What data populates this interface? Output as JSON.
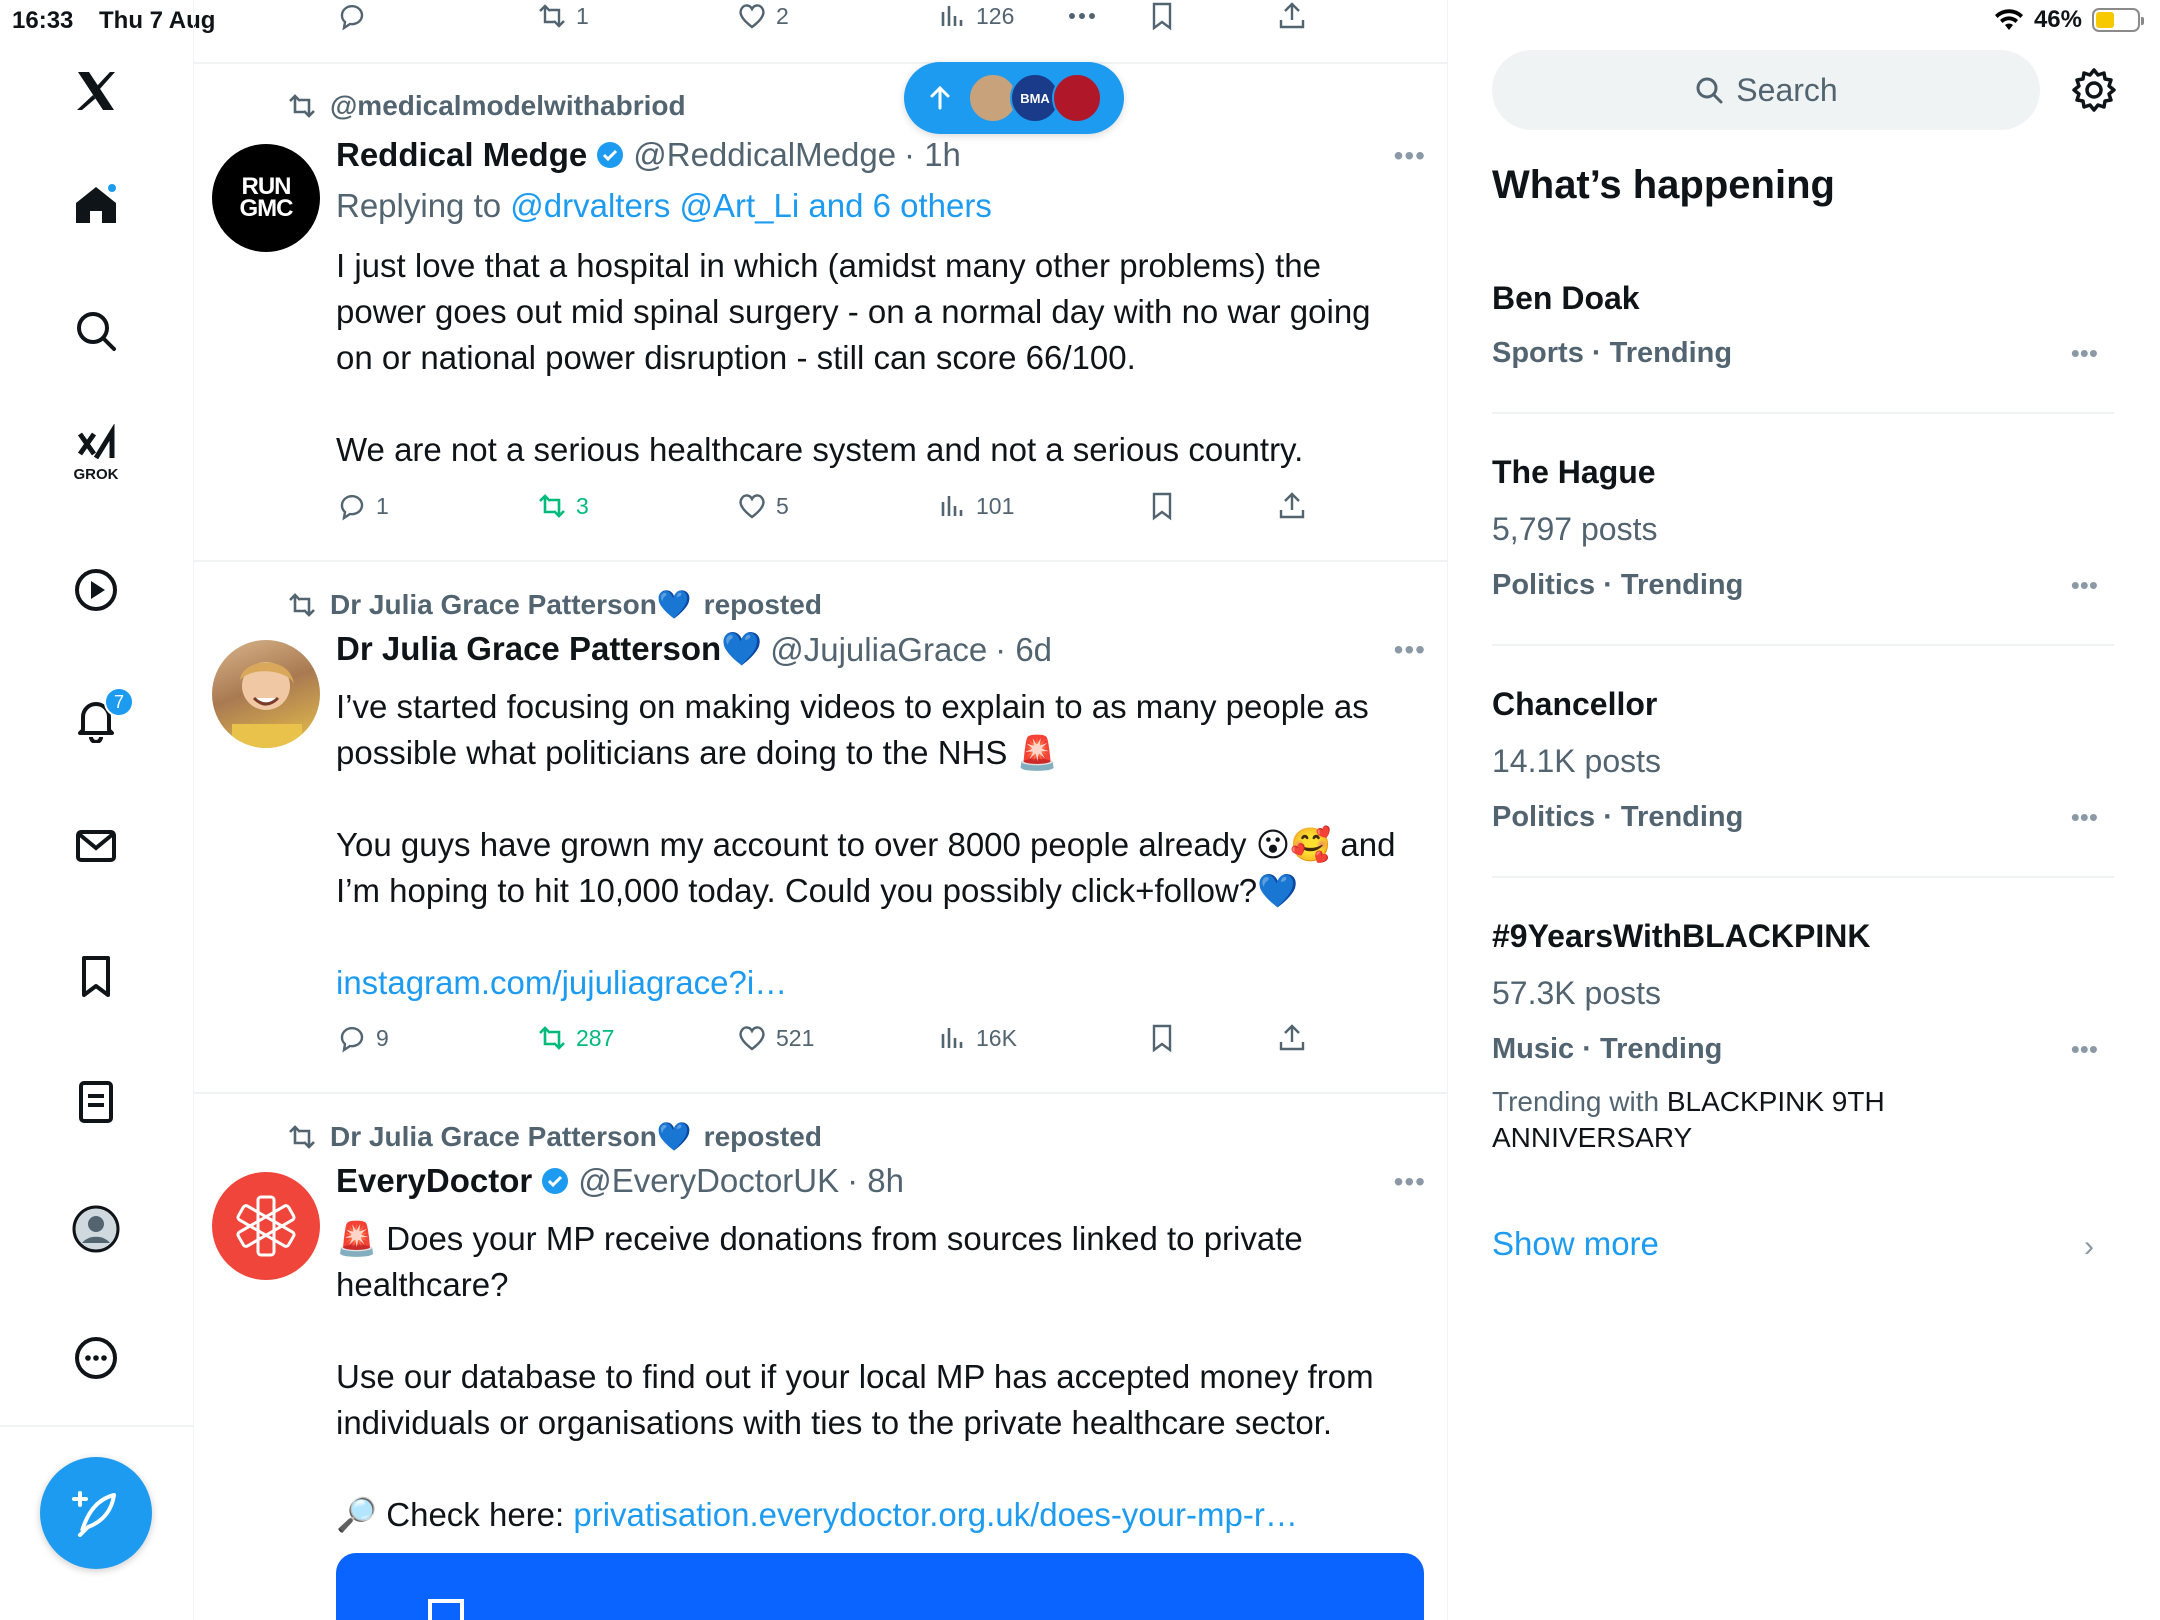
{
  "status_bar": {
    "time": "16:33",
    "date": "Thu 7 Aug",
    "battery": "46%",
    "battery_level": 0.46
  },
  "nav": {
    "grok_label": "GROK",
    "notifications_count": "7"
  },
  "new_posts_pill": {
    "avatar1": "",
    "avatar2": "BMA",
    "avatar3": ""
  },
  "top_partial_actions": {
    "reposts": "1",
    "likes": "2",
    "views": "126"
  },
  "tweets": [
    {
      "repost_label": "@medicalmodelwithabriod",
      "name": "Reddical Medge",
      "handle": "@ReddicalMedge",
      "time": "· 1h",
      "replying_prefix": "Replying to",
      "replying_to": "@drvalters @Art_Li and 6 others",
      "avatar_text": "RUN GMC",
      "body": [
        "I just love that a hospital in which (amidst many other problems) the power goes out mid spinal surgery - on a normal day with no war going on or national power disruption - still can score 66/100.",
        "",
        "We are not a serious healthcare system and not a serious country."
      ],
      "replies": "1",
      "reposts": "3",
      "likes": "5",
      "views": "101"
    },
    {
      "repost_label": "Dr Julia Grace Patterson💙",
      "repost_suffix": "reposted",
      "name": "Dr Julia Grace Patterson💙",
      "handle": "@JujuliaGrace",
      "time": "· 6d",
      "body": [
        "I’ve started focusing on making videos to explain to as many people as possible what politicians are doing to the NHS 🚨",
        "",
        "You guys have grown my account to over 8000 people already 😮🥰 and I’m hoping to hit 10,000 today. Could you possibly click+follow?💙",
        ""
      ],
      "link": "instagram.com/jujuliagrace?i…",
      "replies": "9",
      "reposts": "287",
      "likes": "521",
      "views": "16K"
    },
    {
      "repost_label": "Dr Julia Grace Patterson💙",
      "repost_suffix": "reposted",
      "name": "EveryDoctor",
      "handle": "@EveryDoctorUK",
      "time": "· 8h",
      "body": [
        "🚨 Does your MP receive donations from sources linked to private healthcare?",
        "",
        "Use our database to find out if your local MP has accepted money from individuals or organisations with ties to the private healthcare sector.",
        ""
      ],
      "check_prefix": "🔎 Check here: ",
      "check_link": "privatisation.everydoctor.org.uk/does-your-mp-r…"
    }
  ],
  "right": {
    "search_placeholder": "Search",
    "section_title": "What’s happening",
    "trends": [
      {
        "title": "Ben Doak",
        "posts": "",
        "category": "Sports · Trending"
      },
      {
        "title": "The Hague",
        "posts": "5,797 posts",
        "category": "Politics · Trending"
      },
      {
        "title": "Chancellor",
        "posts": "14.1K posts",
        "category": "Politics · Trending"
      },
      {
        "title": "#9YearsWithBLACKPINK",
        "posts": "57.3K posts",
        "category": "Music · Trending",
        "with_prefix": "Trending with ",
        "with_value": "BLACKPINK 9TH ANNIVERSARY"
      }
    ],
    "show_more": "Show more"
  },
  "colors": {
    "accent": "#1d9bf0",
    "repost_green": "#00ba7c",
    "muted": "#536471"
  }
}
